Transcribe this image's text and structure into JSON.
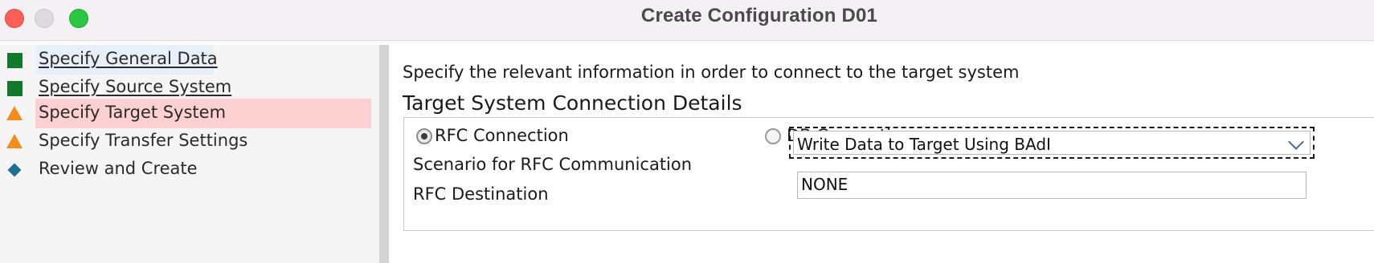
{
  "window": {
    "title": "Create Configuration D01"
  },
  "sidebar": {
    "items": [
      {
        "label": "Specify General Data",
        "icon": "green-square-icon",
        "state": "completed"
      },
      {
        "label": "Specify Source System",
        "icon": "green-square-icon",
        "state": "completed"
      },
      {
        "label": "Specify Target System",
        "icon": "orange-warning-triangle-icon",
        "state": "current"
      },
      {
        "label": "Specify Transfer Settings",
        "icon": "orange-warning-triangle-icon",
        "state": "pending"
      },
      {
        "label": "Review and Create",
        "icon": "blue-diamond-icon",
        "state": "pending"
      }
    ]
  },
  "main": {
    "intro": "Specify the relevant information in order to connect to the target system",
    "group_title": "Target System Connection Details",
    "connection_options": [
      {
        "label": "RFC Connection",
        "selected": true
      },
      {
        "label": "DB Connection",
        "selected": false
      }
    ],
    "scenario": {
      "label": "Scenario for RFC Communication",
      "value": "Write Data to Target Using BAdI"
    },
    "rfc_destination": {
      "label": "RFC Destination",
      "value": "NONE"
    }
  },
  "colors": {
    "completed": "#0f7a2a",
    "warning": "#f58b1a",
    "pending": "#1f6e98",
    "current_highlight": "#fdd0d2"
  }
}
